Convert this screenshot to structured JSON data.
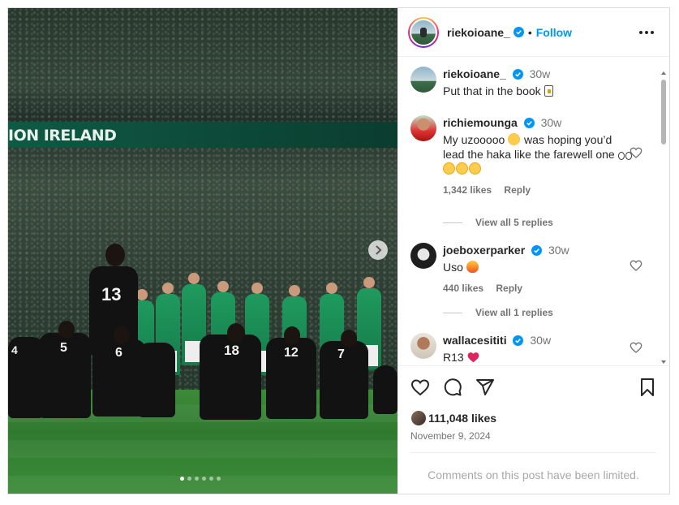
{
  "photo": {
    "banner_text": "ION IRELAND",
    "jersey_number_main": "13",
    "jersey_numbers_kneeling": [
      "4",
      "5",
      "6",
      "18",
      "12",
      "7"
    ],
    "carousel_count": 6,
    "carousel_active": 0
  },
  "header": {
    "username": "riekoioane_",
    "separator": "•",
    "follow_label": "Follow"
  },
  "comments": [
    {
      "username": "riekoioane_",
      "time": "30w",
      "text": "Put that in the book",
      "is_caption": true
    },
    {
      "username": "richiemounga",
      "time": "30w",
      "text_parts": [
        "My uzooooo ",
        " was hoping you’d lead the haka like the farewell one "
      ],
      "likes": "1,342 likes",
      "reply_label": "Reply",
      "view_replies": "View all 5 replies"
    },
    {
      "username": "joeboxerparker",
      "time": "30w",
      "text": "Uso",
      "likes": "440 likes",
      "reply_label": "Reply",
      "view_replies": "View all 1 replies"
    },
    {
      "username": "wallacesititi",
      "time": "30w",
      "text": "R13"
    }
  ],
  "actions": {
    "likes": "111,048 likes",
    "date": "November 9, 2024",
    "limited_notice": "Comments on this post have been limited."
  },
  "colors": {
    "link_blue": "#0095f6",
    "verified_blue": "#0095f6",
    "secondary_text": "#737373",
    "heart_red": "#e0245e"
  }
}
